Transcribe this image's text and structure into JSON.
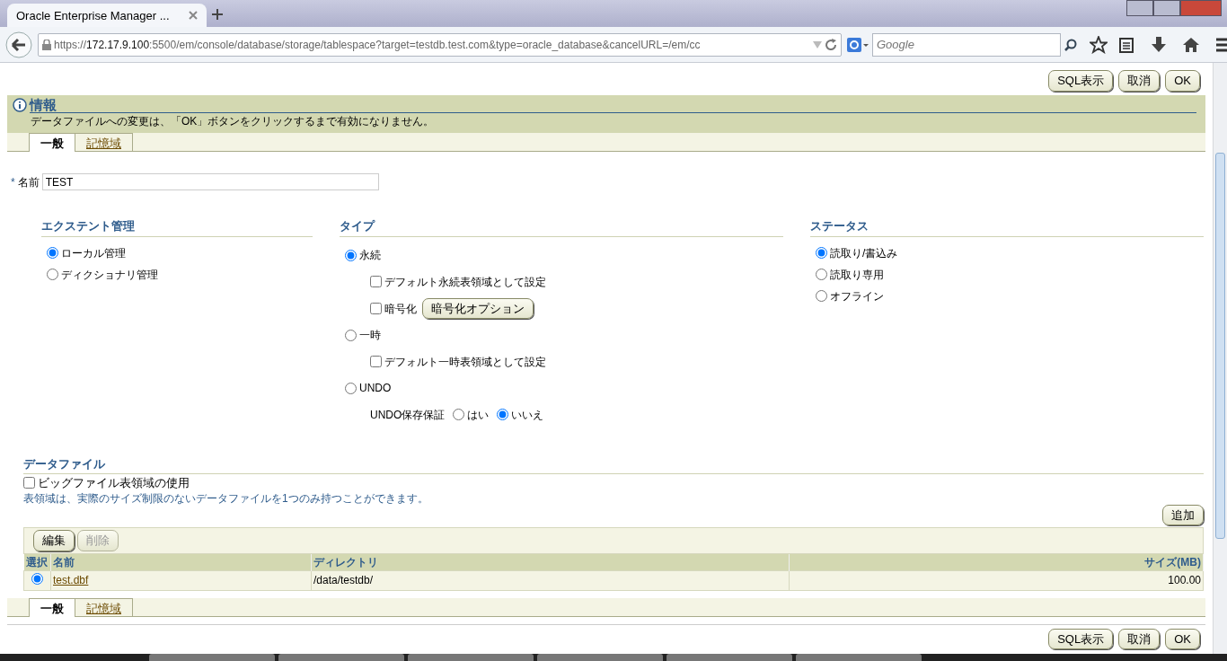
{
  "browser": {
    "tab_title": "Oracle Enterprise Manager ...",
    "url": {
      "scheme": "https://",
      "host": "172.17.9.100",
      "rest": ":5500/em/console/database/storage/tablespace?target=testdb.test.com&type=oracle_database&cancelURL=/em/cc"
    },
    "search": {
      "placeholder": "Google"
    }
  },
  "top_buttons": [
    "SQL表示",
    "取消",
    "OK"
  ],
  "info": {
    "title": "情報",
    "message": "データファイルへの変更は、「OK」ボタンをクリックするまで有効になりません。"
  },
  "tabs": [
    {
      "label": "一般",
      "selected": true
    },
    {
      "label": "記憶域",
      "selected": false
    }
  ],
  "name_field": {
    "required_mark": "*",
    "label": "名前",
    "value": "TEST"
  },
  "extent": {
    "title": "エクステント管理",
    "options": [
      {
        "label": "ローカル管理",
        "selected": true
      },
      {
        "label": "ディクショナリ管理",
        "selected": false
      }
    ]
  },
  "type": {
    "title": "タイプ",
    "options": [
      {
        "label": "永続",
        "selected": true,
        "sub": [
          {
            "kind": "checkbox",
            "label": "デフォルト永続表領域として設定",
            "checked": false
          },
          {
            "kind": "checkbox",
            "label": "暗号化",
            "checked": false,
            "button": "暗号化オプション"
          }
        ]
      },
      {
        "label": "一時",
        "selected": false,
        "sub": [
          {
            "kind": "checkbox",
            "label": "デフォルト一時表領域として設定",
            "checked": false
          }
        ]
      },
      {
        "label": "UNDO",
        "selected": false,
        "sub": [
          {
            "kind": "choice",
            "label": "UNDO保存保証",
            "options": [
              {
                "label": "はい",
                "selected": false
              },
              {
                "label": "いいえ",
                "selected": true
              }
            ]
          }
        ]
      }
    ]
  },
  "status": {
    "title": "ステータス",
    "options": [
      {
        "label": "読取り/書込み",
        "selected": true
      },
      {
        "label": "読取り専用",
        "selected": false
      },
      {
        "label": "オフライン",
        "selected": false
      }
    ]
  },
  "datafiles": {
    "title": "データファイル",
    "bigfile": {
      "label": "ビッグファイル表領域の使用",
      "checked": false
    },
    "note": "表領域は、実際のサイズ制限のないデータファイルを1つのみ持つことができます。",
    "add_button": "追加",
    "toolbar": [
      {
        "label": "編集",
        "disabled": false
      },
      {
        "label": "削除",
        "disabled": true
      }
    ],
    "columns": [
      "選択",
      "名前",
      "ディレクトリ",
      "サイズ(MB)"
    ],
    "rows": [
      {
        "selected": true,
        "name": "test.dbf",
        "directory": "/data/testdb/",
        "size": "100.00"
      }
    ]
  },
  "bottom_tabs": [
    {
      "label": "一般",
      "selected": true
    },
    {
      "label": "記憶域",
      "selected": false
    }
  ],
  "bottom_buttons": [
    "SQL表示",
    "取消",
    "OK"
  ]
}
